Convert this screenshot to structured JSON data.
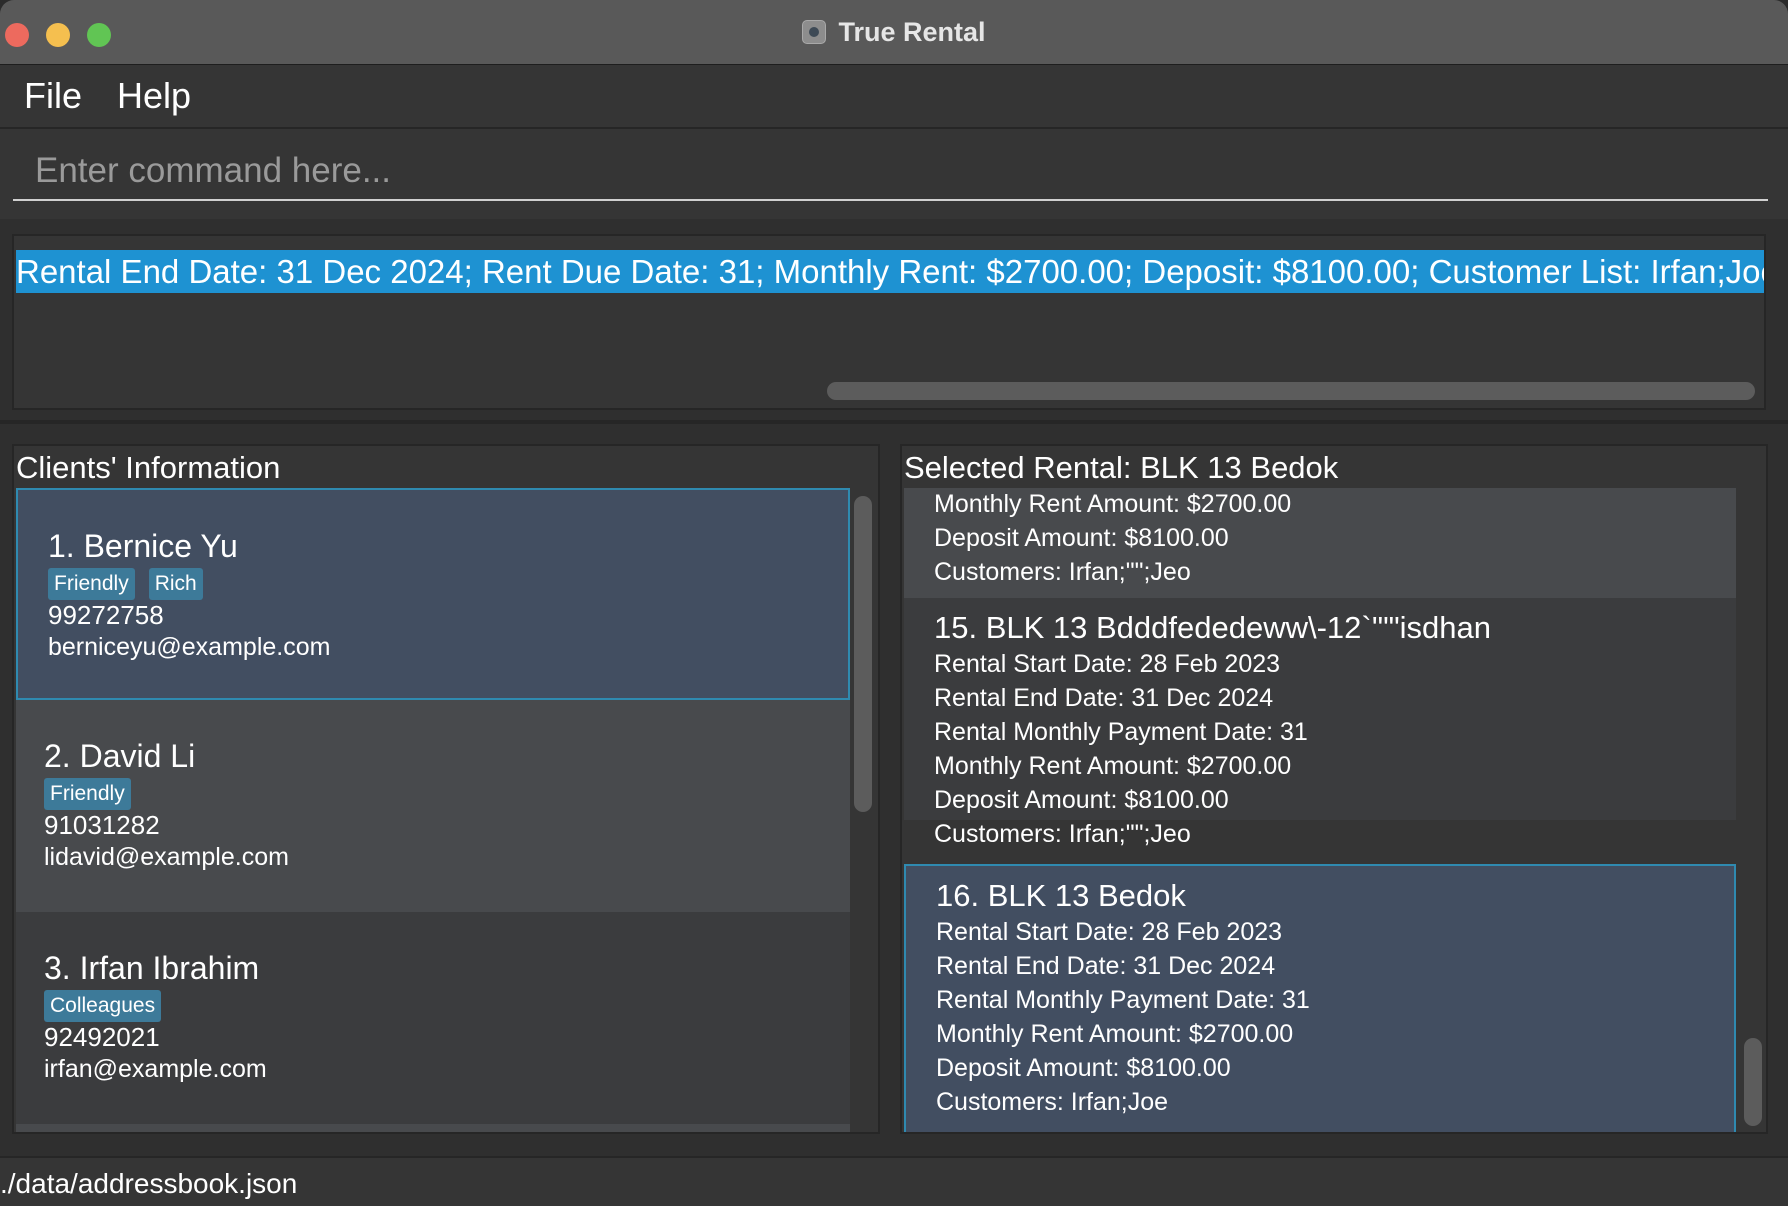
{
  "window": {
    "title": "True Rental"
  },
  "menu": {
    "file": "File",
    "help": "Help"
  },
  "command": {
    "placeholder": "Enter command here..."
  },
  "result": {
    "text": "Rental End Date: 31 Dec 2024; Rent Due Date: 31; Monthly Rent: $2700.00; Deposit: $8100.00; Customer List: Irfan;Joe"
  },
  "clients": {
    "title": "Clients' Information",
    "items": [
      {
        "name": "1. Bernice Yu",
        "tags": [
          "Friendly",
          "Rich"
        ],
        "phone": "99272758",
        "email": "berniceyu@example.com"
      },
      {
        "name": "2. David Li",
        "tags": [
          "Friendly"
        ],
        "phone": "91031282",
        "email": "lidavid@example.com"
      },
      {
        "name": "3. Irfan Ibrahim",
        "tags": [
          "Colleagues"
        ],
        "phone": "92492021",
        "email": "irfan@example.com"
      }
    ]
  },
  "rentals": {
    "title": "Selected Rental: BLK 13 Bedok",
    "partial": {
      "monthly_rent": "Monthly Rent Amount: $2700.00",
      "deposit": "Deposit Amount: $8100.00",
      "customers": "Customers: Irfan;\"\";Jeo"
    },
    "items": [
      {
        "title": "15. BLK 13 Bdddfededeww\\-12`'\"\"isdhan",
        "start": "Rental Start Date: 28 Feb 2023",
        "end": "Rental End Date: 31 Dec 2024",
        "payment_date": "Rental Monthly Payment Date: 31",
        "monthly_rent": "Monthly Rent Amount: $2700.00",
        "deposit": "Deposit Amount: $8100.00",
        "customers": "Customers: Irfan;\"\";Jeo"
      },
      {
        "title": "16. BLK 13 Bedok",
        "start": "Rental Start Date: 28 Feb 2023",
        "end": "Rental End Date: 31 Dec 2024",
        "payment_date": "Rental Monthly Payment Date: 31",
        "monthly_rent": "Monthly Rent Amount: $2700.00",
        "deposit": "Deposit Amount: $8100.00",
        "customers": "Customers: Irfan;Joe"
      }
    ]
  },
  "status": {
    "path": "./data/addressbook.json"
  },
  "colors": {
    "selection_highlight": "#1e92d2",
    "selected_card": "#424e61",
    "tag_bg": "#3d7a99",
    "close": "#ed6a5e",
    "minimize": "#f5bf4f",
    "maximize": "#61c554"
  }
}
